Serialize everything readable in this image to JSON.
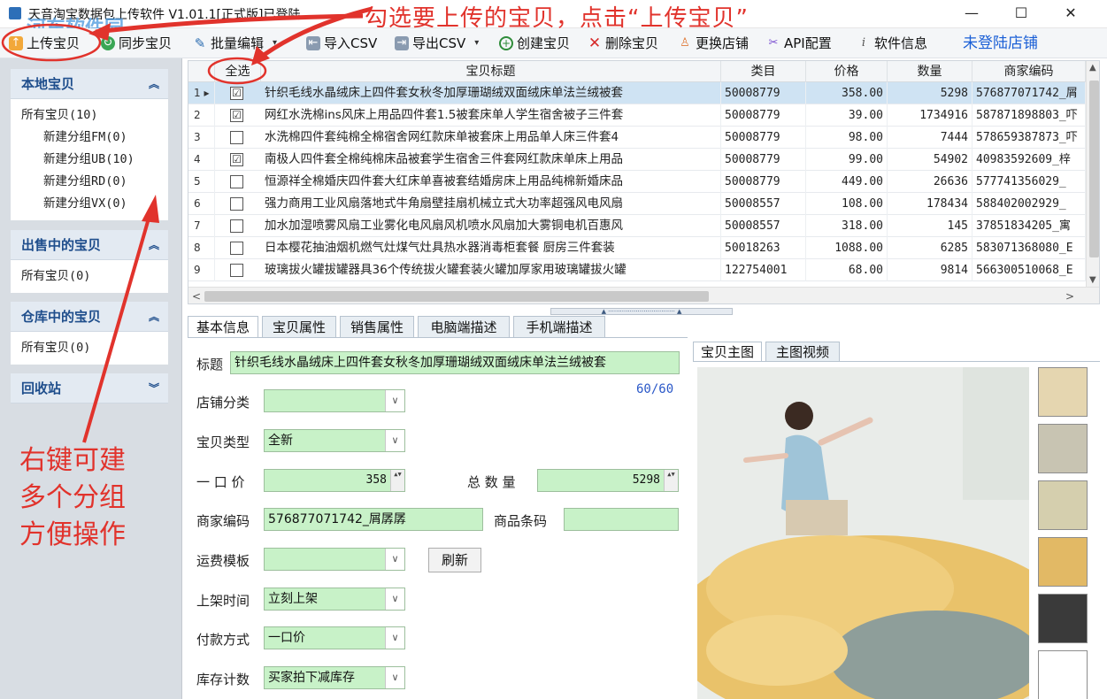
{
  "window": {
    "title": "天音淘宝数据包上传软件 V1.01.1[正式版]已登陆",
    "min": "—",
    "max": "☐",
    "close": "✕"
  },
  "watermark": "河东软件园",
  "toolbar": {
    "upload": "上传宝贝",
    "sync": "同步宝贝",
    "batch_edit": "批量编辑",
    "import_csv": "导入CSV",
    "export_csv": "导出CSV",
    "create": "创建宝贝",
    "delete": "删除宝贝",
    "change_store": "更换店铺",
    "api_config": "API配置",
    "software_info": "软件信息",
    "login_status": "未登陆店铺",
    "dropdown_glyph": "▾"
  },
  "sidebar": {
    "local": {
      "title": "本地宝贝",
      "chev": "︽",
      "items": [
        "所有宝贝(10)",
        "新建分组FM(0)",
        "新建分组UB(10)",
        "新建分组RD(0)",
        "新建分组VX(0)"
      ]
    },
    "selling": {
      "title": "出售中的宝贝",
      "chev": "︽",
      "items": [
        "所有宝贝(0)"
      ]
    },
    "warehouse": {
      "title": "仓库中的宝贝",
      "chev": "︽",
      "items": [
        "所有宝贝(0)"
      ]
    },
    "recycle": {
      "title": "回收站",
      "chev": "︾"
    }
  },
  "grid": {
    "headers": {
      "select_all": "全选",
      "title": "宝贝标题",
      "category": "类目",
      "price": "价格",
      "quantity": "数量",
      "merchant_code": "商家编码"
    },
    "rows": [
      {
        "idx": "1 ▸",
        "checked": "☑",
        "title": "针织毛线水晶绒床上四件套女秋冬加厚珊瑚绒双面绒床单法兰绒被套",
        "category": "50008779",
        "price": "358.00",
        "qty": "5298",
        "code": "576877071742_屑"
      },
      {
        "idx": "2",
        "checked": "☑",
        "title": "网红水洗棉ins风床上用品四件套1.5被套床单人学生宿舍被子三件套",
        "category": "50008779",
        "price": "39.00",
        "qty": "1734916",
        "code": "587871898803_吓"
      },
      {
        "idx": "3",
        "checked": "",
        "title": "水洗棉四件套纯棉全棉宿舍网红款床单被套床上用品单人床三件套4",
        "category": "50008779",
        "price": "98.00",
        "qty": "7444",
        "code": "578659387873_吓"
      },
      {
        "idx": "4",
        "checked": "☑",
        "title": "南极人四件套全棉纯棉床品被套学生宿舍三件套网红款床单床上用品",
        "category": "50008779",
        "price": "99.00",
        "qty": "54902",
        "code": "40983592609_梓"
      },
      {
        "idx": "5",
        "checked": "",
        "title": "恒源祥全棉婚庆四件套大红床单喜被套结婚房床上用品纯棉新婚床品",
        "category": "50008779",
        "price": "449.00",
        "qty": "26636",
        "code": "577741356029_"
      },
      {
        "idx": "6",
        "checked": "",
        "title": "强力商用工业风扇落地式牛角扇壁挂扇机械立式大功率超强风电风扇",
        "category": "50008557",
        "price": "108.00",
        "qty": "178434",
        "code": "588402002929_"
      },
      {
        "idx": "7",
        "checked": "",
        "title": "加水加湿喷雾风扇工业雾化电风扇风机喷水风扇加大雾铜电机百惠风",
        "category": "50008557",
        "price": "318.00",
        "qty": "145",
        "code": "37851834205_寓"
      },
      {
        "idx": "8",
        "checked": "",
        "title": "日本樱花抽油烟机燃气灶煤气灶具热水器消毒柜套餐 厨房三件套装",
        "category": "50018263",
        "price": "1088.00",
        "qty": "6285",
        "code": "583071368080_E"
      },
      {
        "idx": "9",
        "checked": "",
        "title": "玻璃拔火罐拔罐器具36个传统拔火罐套装火罐加厚家用玻璃罐拔火罐",
        "category": "122754001",
        "price": "68.00",
        "qty": "9814",
        "code": "566300510068_E"
      }
    ],
    "hscroll_left": "<",
    "hscroll_right": ">",
    "vscroll_up": "▲",
    "vscroll_down": "▼"
  },
  "splitter_glyph": "▲ ·································· ▲",
  "detail_tabs": [
    "基本信息",
    "宝贝属性",
    "销售属性",
    "电脑端描述",
    "手机端描述"
  ],
  "form": {
    "title_label": "标题",
    "title_value": "针织毛线水晶绒床上四件套女秋冬加厚珊瑚绒双面绒床单法兰绒被套",
    "title_counter": "60/60",
    "store_category_label": "店铺分类",
    "store_category_value": "",
    "item_type_label": "宝贝类型",
    "item_type_value": "全新",
    "price_label": "一 口 价",
    "price_value": "358",
    "total_qty_label": "总 数 量",
    "total_qty_value": "5298",
    "merchant_code_label": "商家编码",
    "merchant_code_value": "576877071742_屑孱孱",
    "barcode_label": "商品条码",
    "barcode_value": "",
    "shipping_label": "运费模板",
    "shipping_value": "",
    "refresh_button": "刷新",
    "listing_time_label": "上架时间",
    "listing_time_value": "立刻上架",
    "payment_label": "付款方式",
    "payment_value": "一口价",
    "stock_label": "库存计数",
    "stock_value": "买家拍下减库存",
    "dropdown_glyph": "∨",
    "spin_glyph": "▲▼"
  },
  "image_tabs": [
    "宝贝主图",
    "主图视频"
  ],
  "annotations": {
    "top": "勾选要上传的宝贝，点击“上传宝贝”",
    "side": "右键可建多个分组方便操作"
  },
  "colors": {
    "annotation": "#e1332c",
    "input_bg": "#c8f2c8",
    "header_blue": "#1f4e8c",
    "login_blue": "#1a5fd6"
  }
}
